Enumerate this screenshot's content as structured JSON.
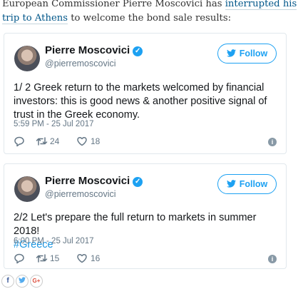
{
  "article": {
    "text_before": "European Commissioner Pierre Moscovici has ",
    "link_text": "interrupted his trip to Athens",
    "text_after": " to welcome the bond sale results:"
  },
  "tweets": [
    {
      "name": "Pierre Moscovici",
      "handle": "@pierremoscovici",
      "follow_label": "Follow",
      "text": "1/ 2 Greek return to the markets welcomed by financial investors: this is good news & another positive signal of trust in the Greek economy.",
      "hashtag": "",
      "timestamp": "5:59 PM - 25 Jul 2017",
      "retweets": "24",
      "likes": "18"
    },
    {
      "name": "Pierre Moscovici",
      "handle": "@pierremoscovici",
      "follow_label": "Follow",
      "text": "2/2 Let's prepare the full return to markets in summer 2018!",
      "hashtag": "#Greece",
      "timestamp": "6:00 PM - 25 Jul 2017",
      "retweets": "15",
      "likes": "16"
    }
  ],
  "share": {
    "facebook_glyph": "f",
    "google_plus_glyph": "G+"
  },
  "icons": {
    "verified": "verified-badge-icon",
    "follow": "twitter-bird-icon",
    "reply": "reply-icon",
    "retweet": "retweet-icon",
    "like": "heart-icon",
    "info": "info-icon"
  },
  "colors": {
    "twitter_blue": "#1da1f2",
    "link": "#005689",
    "facebook": "#3b5998",
    "google_plus": "#dd4b39"
  }
}
